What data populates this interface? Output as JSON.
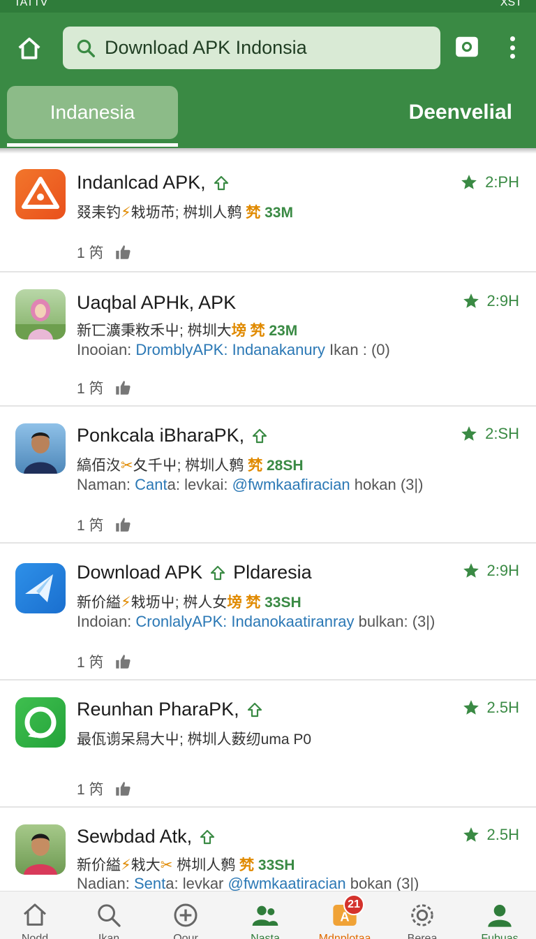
{
  "status_bar": {
    "left": "TATTV",
    "right": "XST"
  },
  "search": {
    "query": "Download APK Indonsia"
  },
  "tabs": [
    {
      "label": "Indanesia",
      "active": true
    },
    {
      "label": "Deenvelial",
      "active": false
    }
  ],
  "colors": {
    "primary": "#3a8a44",
    "primary_dark": "#2f7c3a",
    "link": "#2b78b5",
    "accent": "#e08a00",
    "badge": "#d4322c"
  },
  "items": [
    {
      "title": "Indanlcad APK,",
      "title_suffix": "",
      "meta": "叕耒钓",
      "meta2": "㦵坜芇; 桝圳人鹩",
      "accent": "㭝",
      "size": "33M",
      "sub": null,
      "rating": "2:PH",
      "likes": "1 笍",
      "icon": "orange-warning-app-icon"
    },
    {
      "title": "Uaqbal APHk,  APK",
      "title_suffix": "",
      "meta": "新匸瀇秉敉禾屮; 桝圳大",
      "meta_extra": "塝",
      "accent": "㭝",
      "size": "23M",
      "sub": {
        "prefix": "Inooian:",
        "link1": "DromblyAPK:",
        "link2": "Indanakanury",
        "suffix": "Ikan : (0)"
      },
      "rating": "2:9H",
      "likes": "1 笍",
      "icon": "hijab-woman-photo-icon"
    },
    {
      "title": "Ponkcala iBharaPK,",
      "title_suffix": "",
      "meta": "縞佰汷",
      "meta2": "夂千屮; 桝圳人鹩",
      "accent": "㭝",
      "size": "28SH",
      "sub": {
        "prefix": "Naman:",
        "link1": "Cant",
        "mid": "a: levkai:",
        "link2": "@fwmkaafiracian",
        "suffix": "hokan (3|)"
      },
      "rating": "2:SH",
      "likes": "1 笍",
      "icon": "man-portrait-photo-icon"
    },
    {
      "title": "Download APK",
      "title_suffix": "Pldaresia",
      "meta": "新价縊",
      "meta2": "㦵坜屮; 桝人女",
      "meta_extra": "塝",
      "accent": "㭝",
      "size": "33SH",
      "sub": {
        "prefix": "Indoian:",
        "link1": "CronlalyAPK:",
        "link2": "Indanokaatiranray",
        "suffix": "bulkan: (3|)"
      },
      "rating": "2:9H",
      "likes": "1 笍",
      "icon": "blue-paper-plane-app-icon"
    },
    {
      "title": "Reunhan PharaPK,",
      "title_suffix": "",
      "meta": "最佤谫呆舄大屮; 桝圳人薮纫uma P0",
      "accent": "",
      "size": "",
      "sub": null,
      "rating": "2.5H",
      "likes": "1 笍",
      "icon": "green-circle-app-icon"
    },
    {
      "title": "Sewbdad Atk,",
      "title_suffix": "",
      "meta": "新价縊",
      "meta2": "㦵大",
      "meta3": "桝圳人鹩",
      "accent": "㭝",
      "size": "33SH",
      "sub": {
        "prefix": "Nadian:",
        "link1": "Sent",
        "mid": "a: levkar",
        "link2": "@fwmkaatiracian",
        "suffix": "bokan (3|)"
      },
      "rating": "2.5H",
      "likes": "",
      "icon": "man-red-shirt-photo-icon"
    }
  ],
  "bottom_nav": [
    {
      "label": "Nodd",
      "icon": "home-icon",
      "style": "gray"
    },
    {
      "label": "Ikan",
      "icon": "search-icon",
      "style": "gray"
    },
    {
      "label": "Oour",
      "icon": "add-circle-icon",
      "style": "gray"
    },
    {
      "label": "Nasta",
      "icon": "users-icon",
      "style": "green"
    },
    {
      "label": "Mdnplotaa",
      "icon": "apk-icon",
      "style": "orange",
      "badge": "21"
    },
    {
      "label": "Berea",
      "icon": "settings-icon",
      "style": "gray"
    },
    {
      "label": "Fubuas",
      "icon": "profile-icon",
      "style": "green"
    }
  ]
}
